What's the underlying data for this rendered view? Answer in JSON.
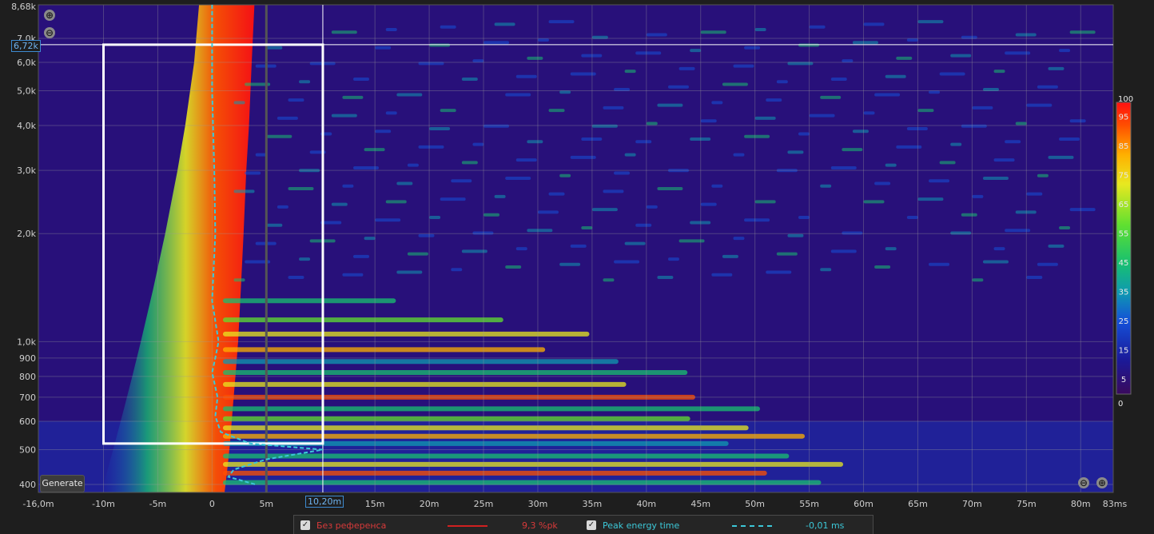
{
  "chart_data": {
    "type": "heatmap",
    "title": "",
    "xlabel": "",
    "ylabel": "",
    "x_unit": "ms",
    "xlim": [
      -16.0,
      83
    ],
    "ylim": [
      380,
      8680
    ],
    "y_scale": "log",
    "x_ticks": [
      {
        "v": -10,
        "label": "-10m"
      },
      {
        "v": -5,
        "label": "-5m"
      },
      {
        "v": 0,
        "label": "0"
      },
      {
        "v": 5,
        "label": "5m"
      },
      {
        "v": 15,
        "label": "15m"
      },
      {
        "v": 20,
        "label": "20m"
      },
      {
        "v": 25,
        "label": "25m"
      },
      {
        "v": 30,
        "label": "30m"
      },
      {
        "v": 35,
        "label": "35m"
      },
      {
        "v": 40,
        "label": "40m"
      },
      {
        "v": 45,
        "label": "45m"
      },
      {
        "v": 50,
        "label": "50m"
      },
      {
        "v": 55,
        "label": "55m"
      },
      {
        "v": 60,
        "label": "60m"
      },
      {
        "v": 65,
        "label": "65m"
      },
      {
        "v": 70,
        "label": "70m"
      },
      {
        "v": 75,
        "label": "75m"
      },
      {
        "v": 80,
        "label": "80m"
      }
    ],
    "x_left_label": "-16,0m",
    "x_right_label": "83ms",
    "y_ticks": [
      {
        "v": 400,
        "label": "400"
      },
      {
        "v": 500,
        "label": "500"
      },
      {
        "v": 600,
        "label": "600"
      },
      {
        "v": 700,
        "label": "700"
      },
      {
        "v": 800,
        "label": "800"
      },
      {
        "v": 900,
        "label": "900"
      },
      {
        "v": 1000,
        "label": "1,0k"
      },
      {
        "v": 2000,
        "label": "2,0k"
      },
      {
        "v": 3000,
        "label": "3,0k"
      },
      {
        "v": 4000,
        "label": "4,0k"
      },
      {
        "v": 5000,
        "label": "5,0k"
      },
      {
        "v": 6000,
        "label": "6,0k"
      },
      {
        "v": 7000,
        "label": "7,0k"
      }
    ],
    "y_top_label": "8,68k",
    "colorscale": {
      "min": 0,
      "max": 100,
      "tick_labels": [
        "100",
        "95",
        "85",
        "75",
        "65",
        "55",
        "45",
        "35",
        "25",
        "15",
        "5",
        "0"
      ],
      "tick_values": [
        100,
        95,
        85,
        75,
        65,
        55,
        45,
        35,
        25,
        15,
        5,
        0
      ],
      "colors": [
        "#3a0a5c",
        "#1a1a9a",
        "#1450d8",
        "#0f9ab0",
        "#18c070",
        "#60e030",
        "#e8e820",
        "#ffb000",
        "#ff5000",
        "#ff1010"
      ]
    },
    "selection_box": {
      "x0": -10,
      "x1": 10.2,
      "y0": 520,
      "y1": 6720
    },
    "cursor": {
      "x": 10.2,
      "x_label": "10,20m",
      "y": 6720,
      "y_label": "6,72k"
    },
    "vertical_marker_x": 5,
    "peak_energy_time": [
      {
        "f": 520,
        "t": 3.5
      },
      {
        "f": 500,
        "t": 10.2
      },
      {
        "f": 470,
        "t": 5
      },
      {
        "f": 440,
        "t": 2
      },
      {
        "f": 420,
        "t": 1.5
      },
      {
        "f": 400,
        "t": 4
      },
      {
        "f": 560,
        "t": 0.8
      },
      {
        "f": 620,
        "t": 0.3
      },
      {
        "f": 700,
        "t": 0.5
      },
      {
        "f": 820,
        "t": 0
      },
      {
        "f": 900,
        "t": 0.3
      },
      {
        "f": 1000,
        "t": 0.6
      },
      {
        "f": 1300,
        "t": 0
      },
      {
        "f": 2000,
        "t": 0.3
      },
      {
        "f": 3000,
        "t": 0.2
      },
      {
        "f": 5000,
        "t": 0
      },
      {
        "f": 8680,
        "t": 0
      }
    ],
    "series": [
      {
        "name": "Без референса",
        "color": "#d02020",
        "style": "solid",
        "value": "9,3 %pk"
      },
      {
        "name": "Peak energy time",
        "color": "#3cc8d8",
        "style": "dashed",
        "value": "-0,01 ms"
      }
    ]
  },
  "controls": {
    "generate_label": "Generate",
    "zoom_in_symbol": "⊕",
    "zoom_out_symbol": "⊖"
  },
  "legend": {
    "item1_label": "Без референса",
    "item1_value": "9,3 %pk",
    "item1_checked": "✓",
    "item2_label": "Peak energy time",
    "item2_value": "-0,01 ms",
    "item2_checked": "✓"
  }
}
